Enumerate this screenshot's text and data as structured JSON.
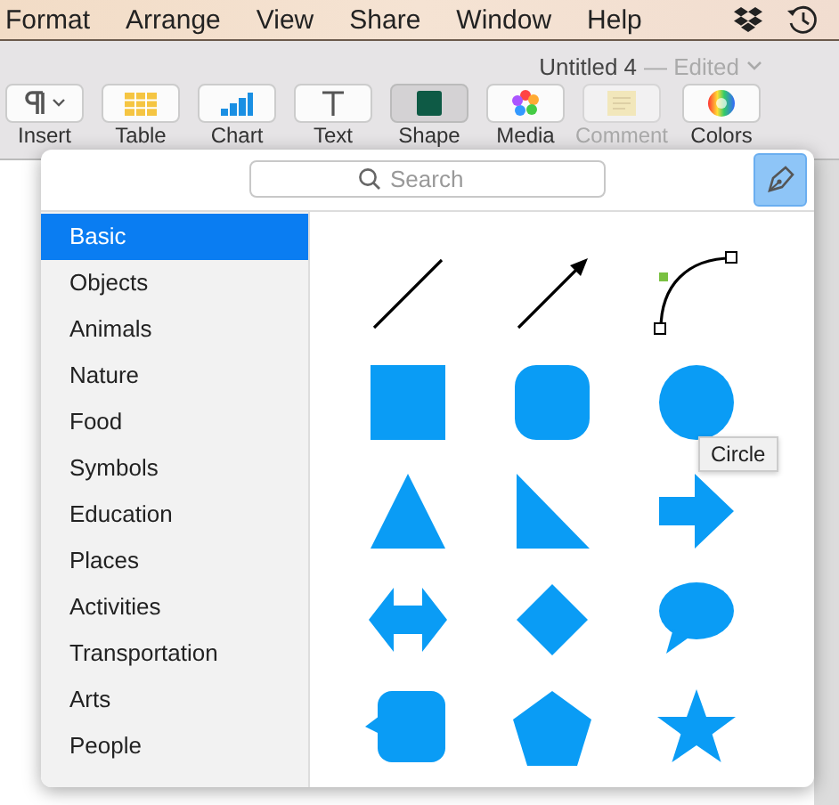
{
  "menu_bar": {
    "items": [
      "Format",
      "Arrange",
      "View",
      "Share",
      "Window",
      "Help"
    ]
  },
  "window": {
    "title": "Untitled 4",
    "status": "— Edited"
  },
  "toolbar": [
    {
      "label": "Insert",
      "kind": "insert",
      "selected": false,
      "disabled": false
    },
    {
      "label": "Table",
      "kind": "table",
      "selected": false,
      "disabled": false
    },
    {
      "label": "Chart",
      "kind": "chart",
      "selected": false,
      "disabled": false
    },
    {
      "label": "Text",
      "kind": "text",
      "selected": false,
      "disabled": false
    },
    {
      "label": "Shape",
      "kind": "shape",
      "selected": true,
      "disabled": false
    },
    {
      "label": "Media",
      "kind": "media",
      "selected": false,
      "disabled": false
    },
    {
      "label": "Comment",
      "kind": "comment",
      "selected": false,
      "disabled": true
    },
    {
      "label": "Colors",
      "kind": "colors",
      "selected": false,
      "disabled": false
    }
  ],
  "shape_popover": {
    "search": {
      "placeholder": "Search"
    },
    "categories": [
      {
        "label": "Basic",
        "selected": true
      },
      {
        "label": "Objects",
        "selected": false
      },
      {
        "label": "Animals",
        "selected": false
      },
      {
        "label": "Nature",
        "selected": false
      },
      {
        "label": "Food",
        "selected": false
      },
      {
        "label": "Symbols",
        "selected": false
      },
      {
        "label": "Education",
        "selected": false
      },
      {
        "label": "Places",
        "selected": false
      },
      {
        "label": "Activities",
        "selected": false
      },
      {
        "label": "Transportation",
        "selected": false
      },
      {
        "label": "Arts",
        "selected": false
      },
      {
        "label": "People",
        "selected": false
      }
    ],
    "shapes": [
      {
        "kind": "line"
      },
      {
        "kind": "arrow-line"
      },
      {
        "kind": "curve"
      },
      {
        "kind": "square"
      },
      {
        "kind": "rounded-square"
      },
      {
        "kind": "circle"
      },
      {
        "kind": "triangle"
      },
      {
        "kind": "right-triangle"
      },
      {
        "kind": "arrow"
      },
      {
        "kind": "double-arrow"
      },
      {
        "kind": "diamond"
      },
      {
        "kind": "speech-bubble"
      },
      {
        "kind": "callout"
      },
      {
        "kind": "pentagon"
      },
      {
        "kind": "star"
      }
    ],
    "tooltip": "Circle"
  }
}
